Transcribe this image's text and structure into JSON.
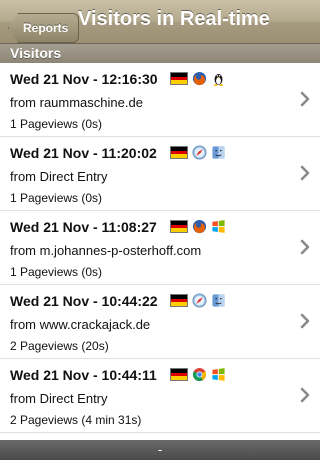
{
  "navbar": {
    "back_label": "Reports",
    "title": "Visitors in Real-time"
  },
  "section": {
    "title": "Visitors"
  },
  "visits": [
    {
      "time": "Wed 21 Nov - 12:16:30",
      "from": "from raummaschine.de",
      "pageviews": "1 Pageviews (0s)",
      "browser": "firefox-icon",
      "os": "linux-icon",
      "flag": "germany-flag"
    },
    {
      "time": "Wed 21 Nov - 11:20:02",
      "from": "from Direct Entry",
      "pageviews": "1 Pageviews (0s)",
      "browser": "safari-icon",
      "os": "mac-icon",
      "flag": "germany-flag"
    },
    {
      "time": "Wed 21 Nov - 11:08:27",
      "from": "from m.johannes-p-osterhoff.com",
      "pageviews": "1 Pageviews (0s)",
      "browser": "firefox-icon",
      "os": "windows-icon",
      "flag": "germany-flag"
    },
    {
      "time": "Wed 21 Nov - 10:44:22",
      "from": "from www.crackajack.de",
      "pageviews": "2 Pageviews (20s)",
      "browser": "safari-icon",
      "os": "mac-icon",
      "flag": "germany-flag"
    },
    {
      "time": "Wed 21 Nov - 10:44:11",
      "from": "from Direct Entry",
      "pageviews": "2 Pageviews (4 min 31s)",
      "browser": "chrome-icon",
      "os": "windows-icon",
      "flag": "germany-flag"
    }
  ],
  "bottombar": {
    "label": "-"
  },
  "colors": {
    "navbar": "#b3a98d",
    "section_header": "#9a9384",
    "bottom_bar": "#555555"
  }
}
